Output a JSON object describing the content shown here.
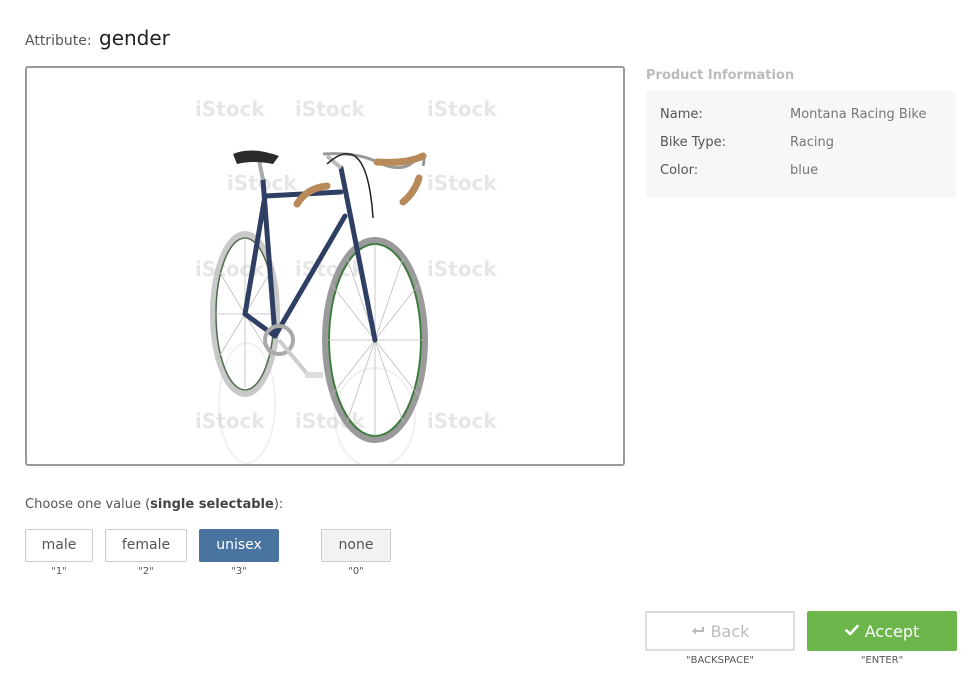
{
  "attribute": {
    "prefix": "Attribute:",
    "name": "gender"
  },
  "product_info": {
    "title": "Product Information",
    "rows": [
      {
        "key": "Name:",
        "value": "Montana Racing Bike"
      },
      {
        "key": "Bike Type:",
        "value": "Racing"
      },
      {
        "key": "Color:",
        "value": "blue"
      }
    ]
  },
  "image": {
    "description_icon": "bicycle-photo",
    "watermark": "iStock by Getty Images"
  },
  "choose": {
    "prefix": "Choose one value (",
    "emphasis": "single selectable",
    "suffix": "):"
  },
  "options": [
    {
      "label": "male",
      "hotkey": "\"1\"",
      "selected": false
    },
    {
      "label": "female",
      "hotkey": "\"2\"",
      "selected": false
    },
    {
      "label": "unisex",
      "hotkey": "\"3\"",
      "selected": true
    },
    {
      "label": "none",
      "hotkey": "\"0\"",
      "selected": false
    }
  ],
  "actions": {
    "back_label": "Back",
    "back_hotkey": "\"BACKSPACE\"",
    "back_icon": "return-arrow-icon",
    "accept_label": "Accept",
    "accept_hotkey": "\"ENTER\"",
    "accept_icon": "checkmark-icon"
  },
  "colors": {
    "selected": "#4a74a0",
    "accept": "#6db64c",
    "bike_frame": "#2f3f63"
  }
}
